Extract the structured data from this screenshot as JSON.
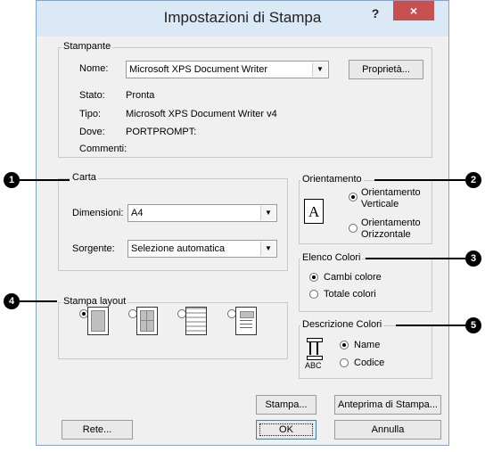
{
  "window": {
    "title": "Impostazioni di Stampa",
    "help": "?",
    "close": "×"
  },
  "stampante": {
    "legend": "Stampante",
    "nome_label": "Nome:",
    "nome_value": "Microsoft XPS Document Writer",
    "proprieta": "Proprietà...",
    "stato_label": "Stato:",
    "stato_value": "Pronta",
    "tipo_label": "Tipo:",
    "tipo_value": "Microsoft XPS Document Writer v4",
    "dove_label": "Dove:",
    "dove_value": "PORTPROMPT:",
    "commenti_label": "Commenti:"
  },
  "carta": {
    "legend": "Carta",
    "dimensioni_label": "Dimensioni:",
    "dimensioni_value": "A4",
    "sorgente_label": "Sorgente:",
    "sorgente_value": "Selezione automatica"
  },
  "orientamento": {
    "legend": "Orientamento",
    "verticale": "Orientamento\nVerticale",
    "orizzontale": "Orientamento\nOrizzontale",
    "icon_letter": "A"
  },
  "elenco": {
    "legend": "Elenco Colori",
    "cambi": "Cambi colore",
    "totale": "Totale colori"
  },
  "stampa_layout": {
    "legend": "Stampa layout"
  },
  "descrizione": {
    "legend": "Descrizione Colori",
    "name": "Name",
    "codice": "Codice",
    "icon_text": "ABC"
  },
  "buttons": {
    "stampa": "Stampa...",
    "anteprima": "Anteprima di Stampa...",
    "rete": "Rete...",
    "ok": "OK",
    "annulla": "Annulla"
  },
  "callouts": [
    "1",
    "2",
    "3",
    "4",
    "5"
  ]
}
